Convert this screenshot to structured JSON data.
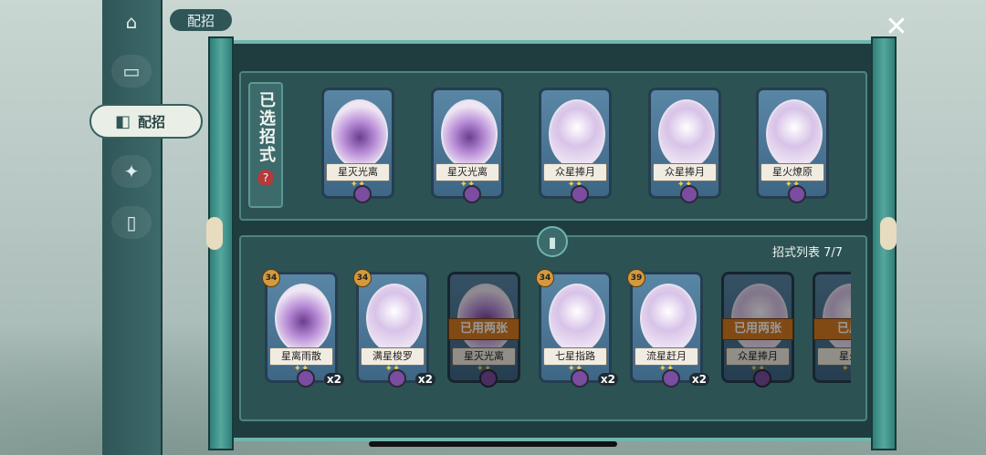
{
  "header": {
    "title": "配招"
  },
  "nav": {
    "active_label": "配招",
    "items": [
      {
        "name": "home",
        "icon": "pavilion-icon"
      },
      {
        "name": "cards",
        "icon": "cards-icon"
      },
      {
        "name": "deck",
        "icon": "deck-icon"
      },
      {
        "name": "emblem",
        "icon": "emblem-icon"
      },
      {
        "name": "phone",
        "icon": "phone-icon"
      }
    ]
  },
  "selected": {
    "label": "已选招式",
    "help": "?",
    "cards": [
      {
        "name": "星灭光离",
        "badge": "",
        "style": "dark"
      },
      {
        "name": "星灭光离",
        "badge": "",
        "style": "dark"
      },
      {
        "name": "众星捧月",
        "badge": "",
        "style": "light"
      },
      {
        "name": "众星捧月",
        "badge": "",
        "style": "light"
      },
      {
        "name": "星火燎原",
        "badge": "",
        "style": "light"
      }
    ]
  },
  "list": {
    "count": "招式列表 7/7",
    "cards": [
      {
        "name": "星离雨散",
        "badge": "34",
        "mult": "x2",
        "used": ""
      },
      {
        "name": "满星梭罗",
        "badge": "34",
        "mult": "x2",
        "used": ""
      },
      {
        "name": "星灭光离",
        "badge": "",
        "mult": "",
        "used": "已用两张"
      },
      {
        "name": "七星指路",
        "badge": "34",
        "mult": "x2",
        "used": ""
      },
      {
        "name": "流星赶月",
        "badge": "39",
        "mult": "x2",
        "used": ""
      },
      {
        "name": "众星捧月",
        "badge": "",
        "mult": "",
        "used": "已用两张"
      },
      {
        "name": "星火",
        "badge": "",
        "mult": "",
        "used": "已用"
      }
    ]
  },
  "colors": {
    "frame": "#1f3d3f",
    "accent": "#6fb6ae",
    "used": "#d77b22"
  }
}
